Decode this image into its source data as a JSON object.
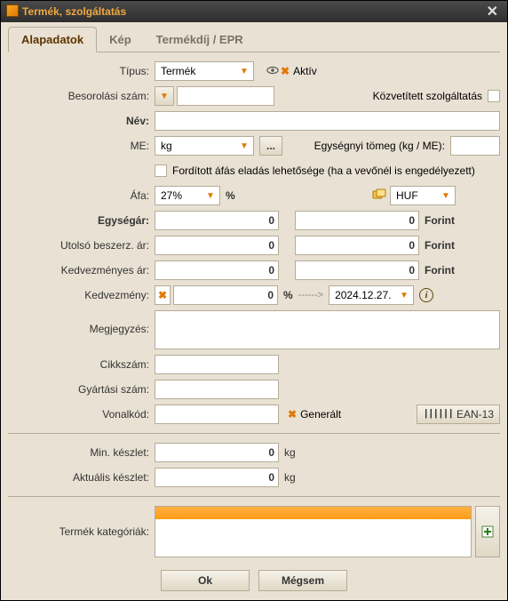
{
  "window": {
    "title": "Termék, szolgáltatás"
  },
  "tabs": {
    "alapadatok": "Alapadatok",
    "kep": "Kép",
    "termekdij": "Termékdíj / EPR"
  },
  "labels": {
    "tipus": "Típus:",
    "aktiv": "Aktív",
    "besorolasi": "Besorolási szám:",
    "kozvetitett": "Közvetített szolgáltatás",
    "nev": "Név:",
    "me": "ME:",
    "egysegnyi_tomeg": "Egységnyi tömeg (kg / ME):",
    "forditott_afa": "Fordított áfás eladás lehetősége (ha a vevőnél is engedélyezett)",
    "afa": "Áfa:",
    "egysegar": "Egységár:",
    "utolso_beszerz": "Utolsó beszerz. ár:",
    "kedvezmenyes_ar": "Kedvezményes ár:",
    "kedvezmeny": "Kedvezmény:",
    "megjegyzes": "Megjegyzés:",
    "cikkszam": "Cikkszám:",
    "gyartasi_szam": "Gyártási szám:",
    "vonalkod": "Vonalkód:",
    "generalt": "Generált",
    "ean13": "EAN-13",
    "min_keszlet": "Min. készlet:",
    "aktualis_keszlet": "Aktuális készlet:",
    "termek_kategoriak": "Termék kategóriák:"
  },
  "values": {
    "tipus": "Termék",
    "me": "kg",
    "afa": "27%",
    "currency": "HUF",
    "egysegar": "0",
    "egysegar2": "0",
    "utolso": "0",
    "utolso2": "0",
    "kedv_ar": "0",
    "kedv_ar2": "0",
    "kedvezmeny": "0",
    "kedv_date": "2024.12.27.",
    "currency_unit": "Forint",
    "percent": "%",
    "arrow": "------>",
    "min_keszlet": "0",
    "aktualis_keszlet": "0",
    "me_unit": "kg"
  },
  "buttons": {
    "ok": "Ok",
    "cancel": "Mégsem",
    "dots": "..."
  }
}
